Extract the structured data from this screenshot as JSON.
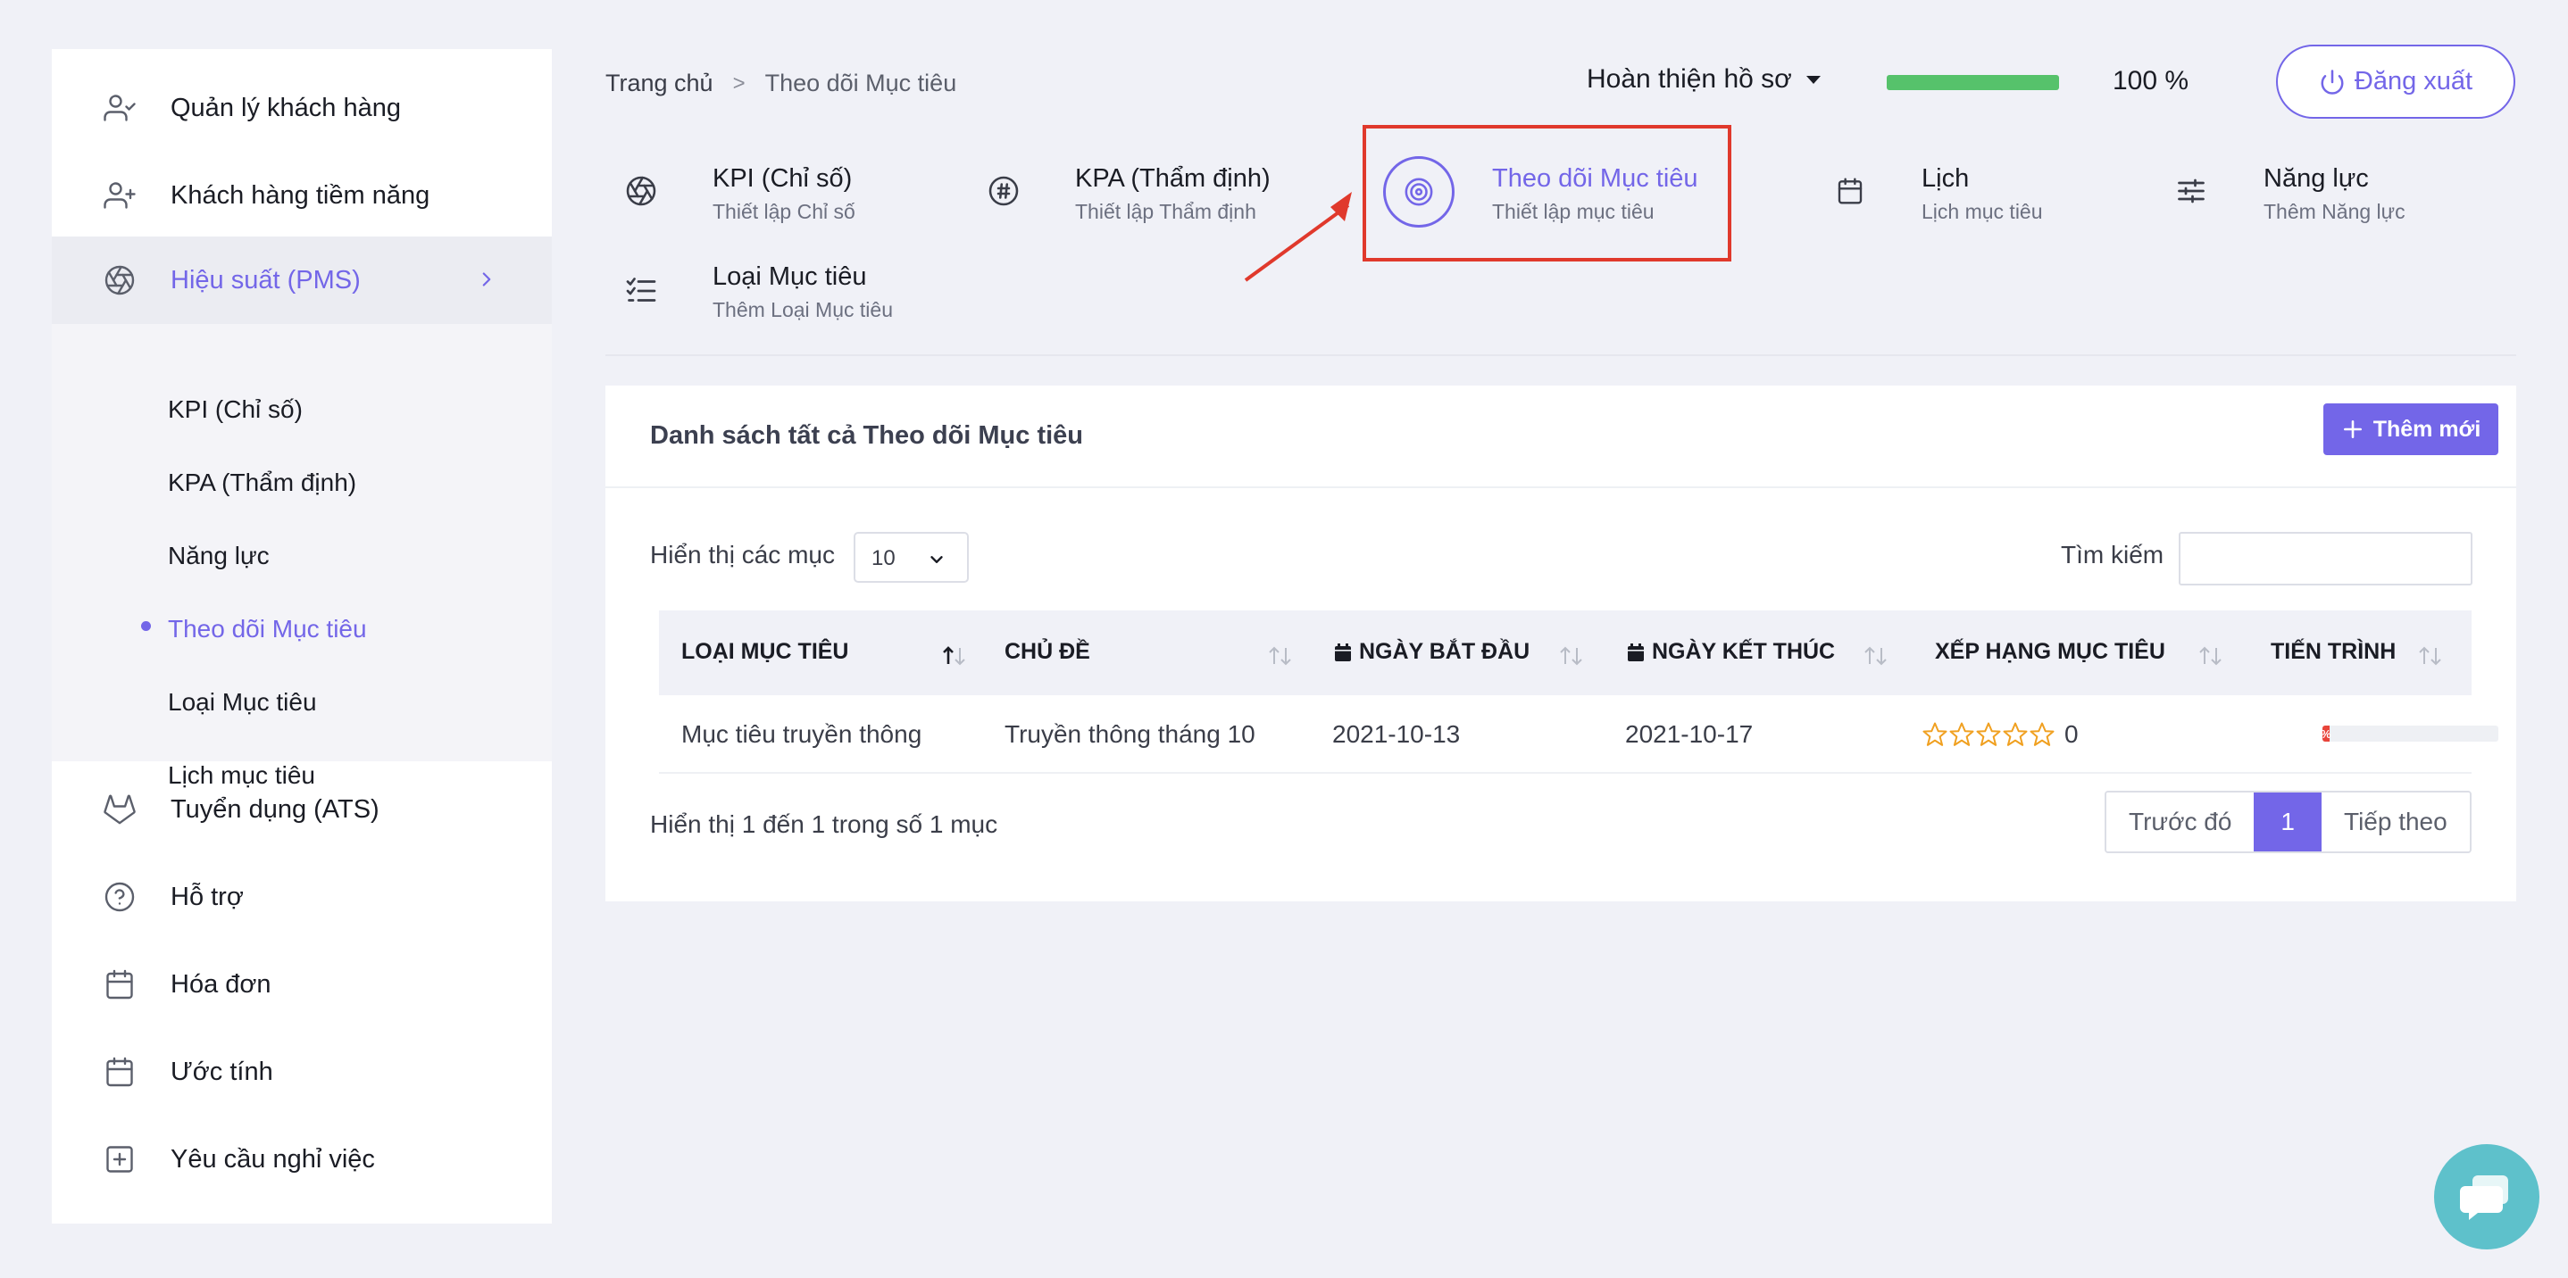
{
  "sidebar": {
    "items": [
      {
        "label": "Quản lý khách hàng",
        "icon": "user-check-icon"
      },
      {
        "label": "Khách hàng tiềm năng",
        "icon": "user-plus-icon"
      },
      {
        "label": "Hiệu suất (PMS)",
        "icon": "aperture-icon"
      },
      {
        "label": "Tuyển dụng (ATS)",
        "icon": "gitlab-icon"
      },
      {
        "label": "Hỗ trợ",
        "icon": "help-circle-icon"
      },
      {
        "label": "Hóa đơn",
        "icon": "calendar-icon"
      },
      {
        "label": "Ước tính",
        "icon": "calendar-icon"
      },
      {
        "label": "Yêu cầu nghỉ việc",
        "icon": "plus-square-icon"
      }
    ],
    "sub_items": [
      {
        "label": "KPI (Chỉ số)"
      },
      {
        "label": "KPA (Thẩm định)"
      },
      {
        "label": "Năng lực"
      },
      {
        "label": "Theo dõi Mục tiêu"
      },
      {
        "label": "Loại Mục tiêu"
      },
      {
        "label": "Lịch mục tiêu"
      }
    ]
  },
  "header": {
    "breadcrumb": {
      "home": "Trang chủ",
      "separator": ">",
      "current": "Theo dõi Mục tiêu"
    },
    "profile_label": "Hoàn thiện hồ sơ",
    "profile_progress": 1.0,
    "profile_pct": "100 %",
    "logout_label": "Đăng xuất"
  },
  "modules": [
    {
      "title": "KPI (Chỉ số)",
      "sub": "Thiết lập Chỉ số",
      "icon": "aperture-icon"
    },
    {
      "title": "KPA (Thẩm định)",
      "sub": "Thiết lập Thẩm định",
      "icon": "hash-icon"
    },
    {
      "title": "Theo dõi Mục tiêu",
      "sub": "Thiết lập mục tiêu",
      "icon": "target-icon"
    },
    {
      "title": "Lịch",
      "sub": "Lịch mục tiêu",
      "icon": "calendar-icon"
    },
    {
      "title": "Năng lực",
      "sub": "Thêm Năng lực",
      "icon": "sliders-icon"
    },
    {
      "title": "Loại Mục tiêu",
      "sub": "Thêm Loại Mục tiêu",
      "icon": "list-check-icon"
    }
  ],
  "card": {
    "title": "Danh sách tất cả Theo dõi Mục tiêu",
    "add_label": "Thêm mới",
    "show_label": "Hiển thị các mục",
    "page_size": "10",
    "search_label": "Tìm kiếm",
    "search_value": "",
    "columns": [
      "LOẠI MỤC TIÊU",
      "CHỦ ĐỀ",
      "NGÀY BẮT ĐẦU",
      "NGÀY KẾT THÚC",
      "XẾP HẠNG MỤC TIÊU",
      "TIẾN TRÌNH"
    ],
    "rows": [
      {
        "type": "Mục tiêu truyền thông",
        "topic": "Truyền thông tháng 10",
        "start": "2021-10-13",
        "end": "2021-10-17",
        "rating": 0,
        "rating_text": "0",
        "progress_label": "%",
        "progress": 0.04
      }
    ],
    "info": "Hiển thị 1 đến 1 trong số 1 mục",
    "pager": {
      "prev": "Trước đó",
      "current": "1",
      "next": "Tiếp theo"
    }
  },
  "colors": {
    "accent": "#7366e8",
    "progress": "#56c26b",
    "highlight": "#e0392c",
    "chat": "#5ec1cb"
  }
}
